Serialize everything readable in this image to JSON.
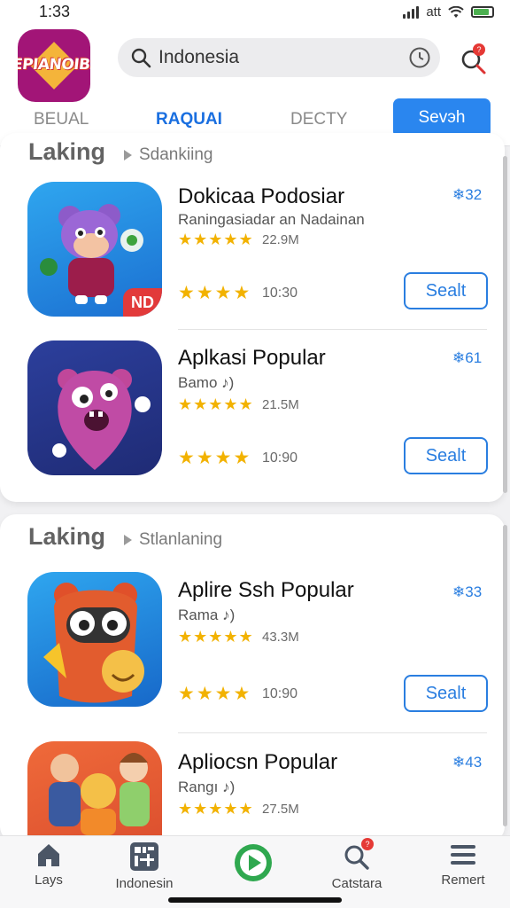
{
  "status_bar": {
    "time": "1:33",
    "carrier": "att"
  },
  "app": {
    "logo_text": "EPIANOIBZ"
  },
  "search": {
    "value": "Indonesia"
  },
  "tabs": [
    {
      "label": "BEUAL"
    },
    {
      "label": "RAQUAI"
    },
    {
      "label": "DECTY"
    }
  ],
  "header_button": {
    "label": "Sevэh"
  },
  "notification_badge": "?",
  "sections": [
    {
      "title": "Laking",
      "subtitle": "Sdankiing",
      "apps": [
        {
          "name": "Dokicaa Podosiar",
          "subtitle": "Raningasiadar an Nadainan",
          "rank": "❄32",
          "rating_stars": "★★★★★",
          "downloads": "22.9M",
          "stars_row": "★★★★",
          "time": "10:30",
          "button": "Sealt",
          "badge": "ND"
        },
        {
          "name": "Aplkasi Popular",
          "subtitle": "Bamo ♪)",
          "rank": "❄61",
          "rating_stars": "★★★★★",
          "downloads": "21.5M",
          "stars_row": "★★★★",
          "time": "10:90",
          "button": "Sealt"
        }
      ]
    },
    {
      "title": "Laking",
      "subtitle": "Stlanlaning",
      "apps": [
        {
          "name": "Aplire Ssh Popular",
          "subtitle": "Rama ♪)",
          "rank": "❄33",
          "rating_stars": "★★★★★",
          "downloads": "43.3M",
          "stars_row": "★★★★",
          "time": "10:90",
          "button": "Sealt"
        },
        {
          "name": "Apliocsn Popular",
          "subtitle": "Rangı ♪)",
          "rank": "❄43",
          "rating_stars": "★★★★★",
          "downloads": "27.5M"
        }
      ]
    }
  ],
  "bottom_nav": [
    {
      "label": "Lays",
      "icon": "home-icon"
    },
    {
      "label": "Indonesin",
      "icon": "grid-icon"
    },
    {
      "label": "",
      "icon": "play-icon"
    },
    {
      "label": "Catstara",
      "icon": "search-icon"
    },
    {
      "label": "Remert",
      "icon": "menu-icon"
    }
  ],
  "colors": {
    "accent": "#1a6fe0",
    "button": "#2a86ef",
    "star": "#f2b200",
    "logo_bg": "#a21577",
    "play": "#2fa84f"
  }
}
